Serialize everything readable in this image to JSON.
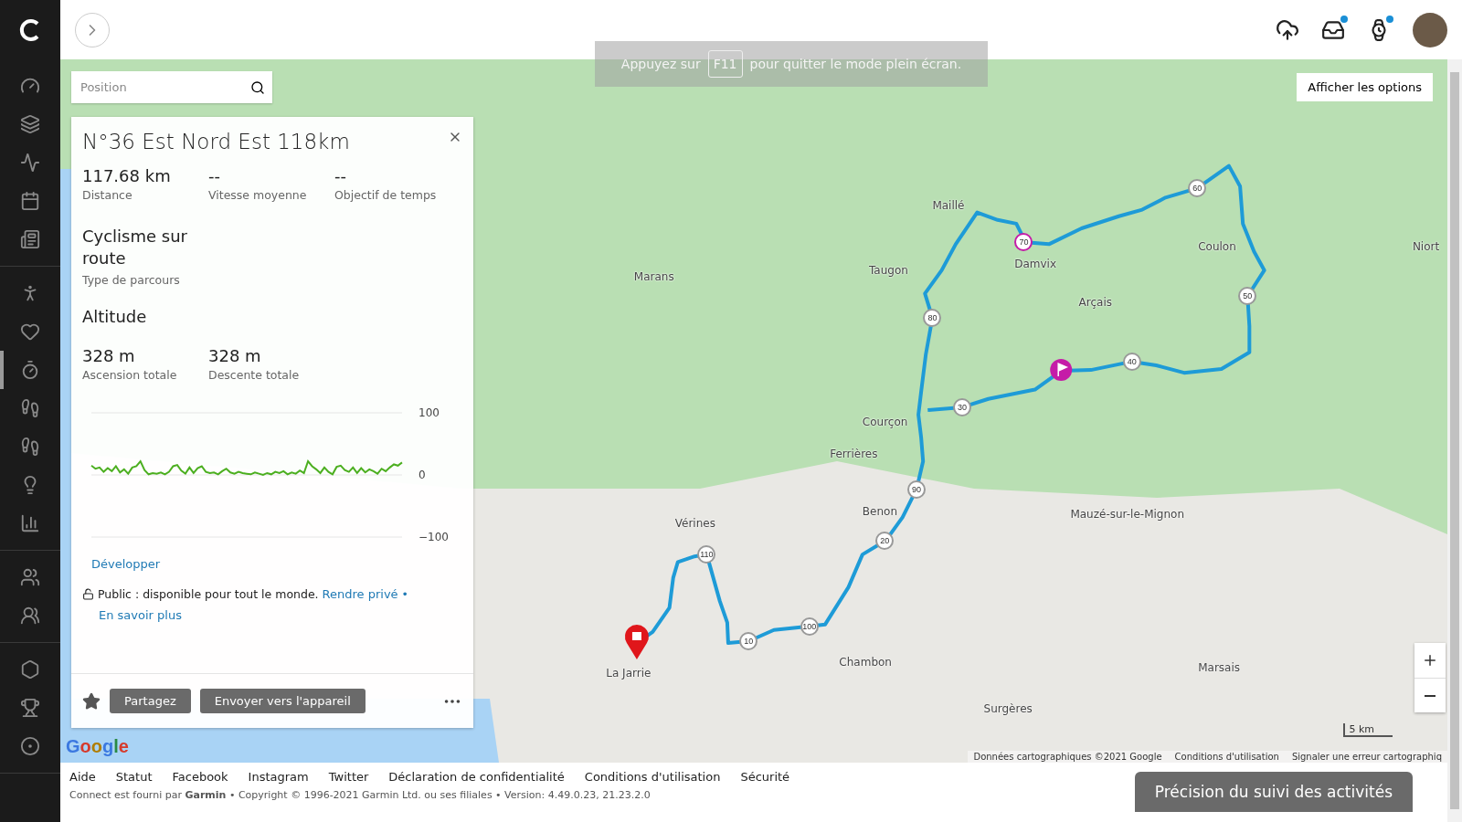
{
  "sidebar": {
    "items": [
      {
        "selected": false
      },
      {
        "selected": false
      },
      {
        "selected": false
      },
      {
        "selected": false
      },
      {
        "selected": false
      },
      {
        "selected": false
      },
      {
        "selected": false
      },
      {
        "selected": true
      },
      {
        "selected": false
      },
      {
        "selected": false
      },
      {
        "selected": false
      },
      {
        "selected": false
      },
      {
        "selected": false
      },
      {
        "selected": false
      },
      {
        "selected": false
      },
      {
        "selected": false
      },
      {
        "selected": false
      }
    ]
  },
  "header": {
    "icons": [
      {
        "notification": false
      },
      {
        "notification": true
      },
      {
        "notification": true
      }
    ]
  },
  "fullscreen_notice": {
    "before": "Appuyez sur",
    "key": "F11",
    "after": "pour quitter le mode plein écran."
  },
  "map": {
    "search": {
      "placeholder": "Position"
    },
    "options_button": "Afficher les options",
    "places": [
      "Marans",
      "Damvix",
      "Maillé",
      "Niort",
      "La Jarrie",
      "Courçon",
      "Benon",
      "Surgères",
      "Ferrières",
      "Arçais",
      "Coulon",
      "Taugon",
      "Vérines",
      "Chambon",
      "Mauzé-sur-le-Mignon",
      "Marsais"
    ],
    "route_markers": [
      "10",
      "20",
      "30",
      "40",
      "50",
      "60",
      "70",
      "80",
      "90",
      "100",
      "110"
    ],
    "scale": "5 km",
    "logo": "Google",
    "attribution": [
      "Données cartographiques ©2021 Google",
      "Conditions d'utilisation",
      "Signaler une erreur cartographiq"
    ]
  },
  "route_panel": {
    "title": "N°36 Est Nord Est 118km",
    "stats": [
      {
        "value": "117.68 km",
        "label": "Distance"
      },
      {
        "value": "--",
        "label": "Vitesse moyenne"
      },
      {
        "value": "--",
        "label": "Objectif de temps"
      }
    ],
    "course_type": {
      "value": "Cyclisme sur route",
      "label": "Type de parcours"
    },
    "altitude_title": "Altitude",
    "elevation": [
      {
        "value": "328 m",
        "label": "Ascension totale"
      },
      {
        "value": "328 m",
        "label": "Descente totale"
      }
    ],
    "chart_data": {
      "type": "line",
      "ylim": [
        -100,
        100
      ],
      "yticks": [
        100,
        0,
        {
          "value": -100,
          "label": "−100"
        }
      ],
      "series": [
        {
          "color": "#4caf20",
          "values": [
            15,
            10,
            12,
            5,
            11,
            6,
            14,
            4,
            9,
            2,
            12,
            14,
            22,
            8,
            1,
            3,
            2,
            4,
            1,
            5,
            14,
            16,
            7,
            2,
            12,
            3,
            11,
            14,
            5,
            3,
            4,
            1,
            6,
            10,
            4,
            2,
            5,
            3,
            2,
            1,
            4,
            2,
            0,
            3,
            1,
            5,
            3,
            6,
            1,
            4,
            2,
            7,
            3,
            22,
            14,
            9,
            3,
            12,
            5,
            1,
            13,
            15,
            8,
            5,
            12,
            3,
            11,
            4,
            9,
            6,
            2,
            10,
            6,
            12,
            17,
            15,
            20
          ]
        }
      ]
    },
    "expand_link": "Développer",
    "privacy": {
      "text": "Public : disponible pour tout le monde.",
      "link": "Rendre privé",
      "separator": "•",
      "learn_more": "En savoir plus"
    },
    "favorite": false,
    "buttons": [
      "Partagez",
      "Envoyer vers l'appareil"
    ]
  },
  "footer": {
    "links": [
      "Aide",
      "Statut",
      "Facebook",
      "Instagram",
      "Twitter",
      "Déclaration de confidentialité",
      "Conditions d'utilisation",
      "Sécurité"
    ],
    "copyright": "Connect est fourni par **Garmin** • Copyright © 1996-2021 Garmin Ltd. ou ses filiales • Version: 4.49.0.23, 21.23.2.0",
    "feedback_button": "Précision du suivi des activités"
  }
}
